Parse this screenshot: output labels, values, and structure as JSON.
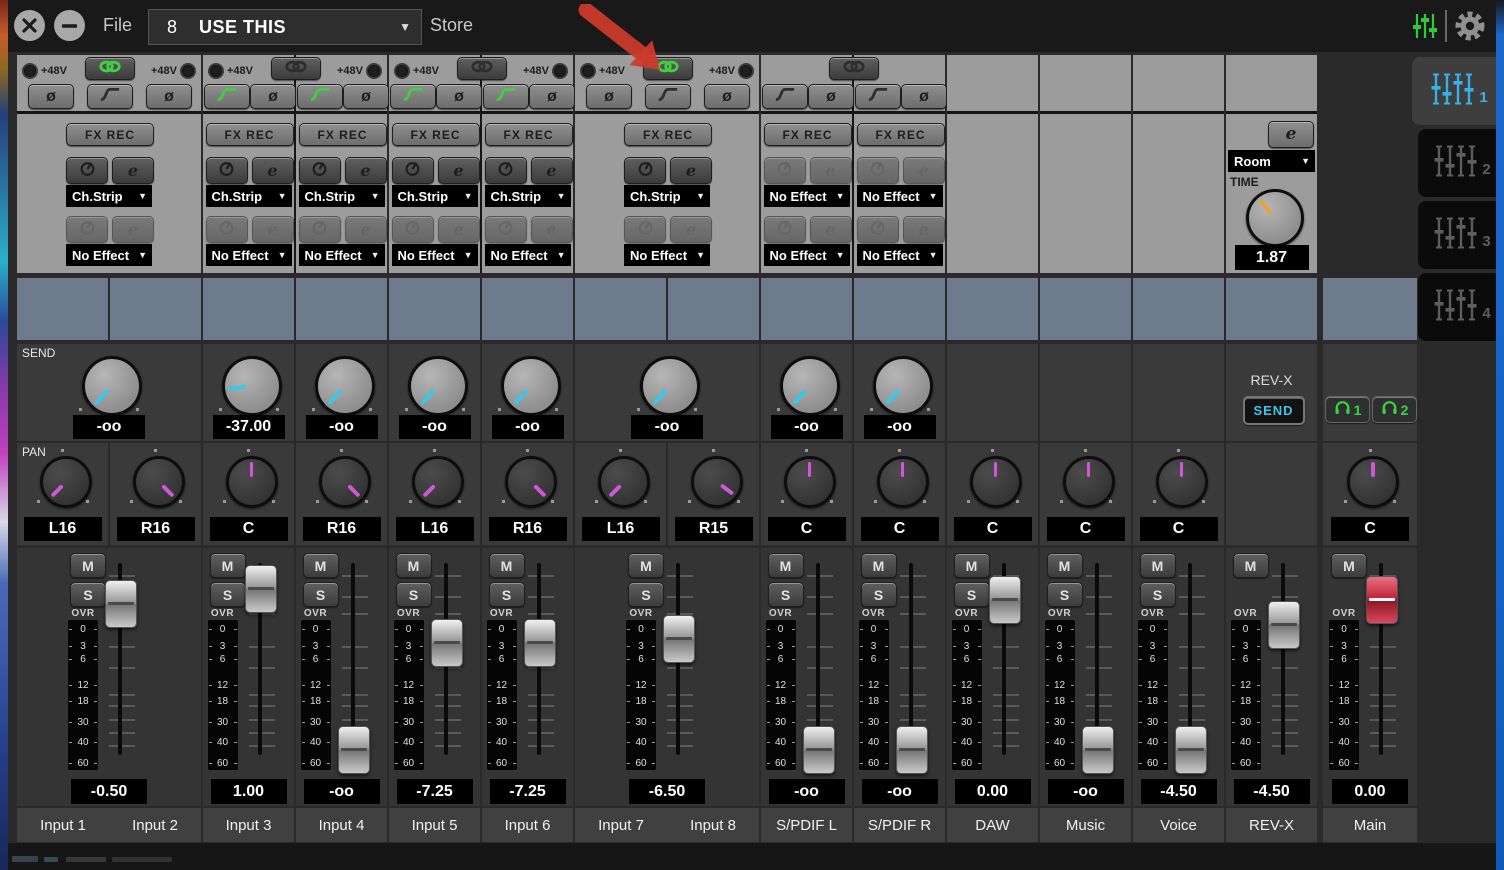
{
  "titlebar": {
    "file_label": "File",
    "preset_number": "8",
    "preset_name": "USE THIS",
    "store_label": "Store"
  },
  "labels": {
    "send_section": "SEND",
    "pan_section": "PAN",
    "ovr": "OVR",
    "phantom": "+48V",
    "fx_rec": "FX REC",
    "mute": "M",
    "solo": "S"
  },
  "meter_ticks": [
    "0",
    "3",
    "6",
    "12",
    "18",
    "30",
    "40",
    "60"
  ],
  "revx_editor": {
    "type_value": "Room",
    "time_label": "TIME",
    "time_value": "1.87"
  },
  "revx_send": {
    "title": "REV-X",
    "send_button": "SEND"
  },
  "phones": [
    {
      "label": "1"
    },
    {
      "label": "2"
    }
  ],
  "scene_tabs": [
    {
      "label": "1",
      "active": true
    },
    {
      "label": "2",
      "active": false
    },
    {
      "label": "3",
      "active": false
    },
    {
      "label": "4",
      "active": false
    }
  ],
  "strips": [
    {
      "id": "input-1-2",
      "type": "pair",
      "linked": true,
      "phantom": true,
      "names": [
        "Input 1",
        "Input 2"
      ],
      "fx": {
        "slot1": "Ch.Strip",
        "slot2": "No Effect",
        "active": true
      },
      "send": {
        "value": "-oo",
        "angle": -137
      },
      "pans": [
        {
          "value": "L16",
          "angle": -135
        },
        {
          "value": "R16",
          "angle": 135
        }
      ],
      "fader": {
        "value": "-0.50",
        "pos": 0.21
      }
    },
    {
      "id": "input-3-4",
      "type": "pair",
      "linked": false,
      "phantom": true,
      "names": [
        "Input 3",
        "Input 4"
      ],
      "channels": [
        {
          "hpf": true,
          "fx": {
            "slot1": "Ch.Strip",
            "slot2": "No Effect",
            "active": true
          },
          "send": {
            "value": "-37.00",
            "angle": -97
          },
          "pan": {
            "value": "C",
            "angle": 0
          },
          "fader": {
            "value": "1.00",
            "pos": 0.13
          }
        },
        {
          "hpf": true,
          "fx": {
            "slot1": "Ch.Strip",
            "slot2": "No Effect",
            "active": true
          },
          "send": {
            "value": "-oo",
            "angle": -137
          },
          "pan": {
            "value": "R16",
            "angle": 135
          },
          "fader": {
            "value": "-oo",
            "pos": 0.97
          }
        }
      ]
    },
    {
      "id": "input-5-6",
      "type": "pair",
      "linked": false,
      "phantom": true,
      "names": [
        "Input 5",
        "Input 6"
      ],
      "channels": [
        {
          "hpf": true,
          "fx": {
            "slot1": "Ch.Strip",
            "slot2": "No Effect",
            "active": true
          },
          "send": {
            "value": "-oo",
            "angle": -137
          },
          "pan": {
            "value": "L16",
            "angle": -135
          },
          "fader": {
            "value": "-7.25",
            "pos": 0.41
          }
        },
        {
          "hpf": true,
          "fx": {
            "slot1": "Ch.Strip",
            "slot2": "No Effect",
            "active": true
          },
          "send": {
            "value": "-oo",
            "angle": -137
          },
          "pan": {
            "value": "R16",
            "angle": 135
          },
          "fader": {
            "value": "-7.25",
            "pos": 0.41
          }
        }
      ]
    },
    {
      "id": "input-7-8",
      "type": "pair",
      "linked": true,
      "phantom": true,
      "names": [
        "Input 7",
        "Input 8"
      ],
      "fx": {
        "slot1": "Ch.Strip",
        "slot2": "No Effect",
        "active": true
      },
      "send": {
        "value": "-oo",
        "angle": -137
      },
      "pans": [
        {
          "value": "L16",
          "angle": -135
        },
        {
          "value": "R15",
          "angle": 127
        }
      ],
      "fader": {
        "value": "-6.50",
        "pos": 0.39
      }
    },
    {
      "id": "spdif",
      "type": "pair",
      "linked": false,
      "phantom": false,
      "names": [
        "S/PDIF L",
        "S/PDIF R"
      ],
      "channels": [
        {
          "hpf": false,
          "fx": {
            "slot1": "No Effect",
            "slot2": "No Effect",
            "active": false
          },
          "send": {
            "value": "-oo",
            "angle": -137
          },
          "pan": {
            "value": "C",
            "angle": 0
          },
          "fader": {
            "value": "-oo",
            "pos": 0.97
          }
        },
        {
          "hpf": false,
          "fx": {
            "slot1": "No Effect",
            "slot2": "No Effect",
            "active": false
          },
          "send": {
            "value": "-oo",
            "angle": -137
          },
          "pan": {
            "value": "C",
            "angle": 0
          },
          "fader": {
            "value": "-oo",
            "pos": 0.97
          }
        }
      ]
    },
    {
      "id": "daw",
      "type": "single",
      "name": "DAW",
      "pan": {
        "value": "C",
        "angle": 0
      },
      "fader": {
        "value": "0.00",
        "pos": 0.19
      }
    },
    {
      "id": "music",
      "type": "single",
      "name": "Music",
      "pan": {
        "value": "C",
        "angle": 0
      },
      "fader": {
        "value": "-oo",
        "pos": 0.97
      }
    },
    {
      "id": "voice",
      "type": "single",
      "name": "Voice",
      "pan": {
        "value": "C",
        "angle": 0
      },
      "fader": {
        "value": "-4.50",
        "pos": 0.97
      }
    },
    {
      "id": "revx",
      "type": "revx",
      "name": "REV-X",
      "fader": {
        "value": "-4.50",
        "pos": 0.32
      }
    },
    {
      "id": "main",
      "type": "main",
      "name": "Main",
      "pan": {
        "value": "C",
        "angle": 0
      },
      "fader": {
        "value": "0.00",
        "pos": 0.19
      }
    }
  ],
  "strip_fader_values": [
    "-0.50",
    "1.00",
    "-oo",
    "-7.25",
    "-7.25",
    "-6.50",
    "-oo",
    "-oo",
    "0.00",
    "-oo",
    "-oo",
    "-4.50",
    "0.00"
  ],
  "colors": {
    "accent_green": "#3fd13f",
    "accent_cyan": "#38c8ea",
    "pan_indicator": "#d058d8",
    "time_indicator": "#e8a23a",
    "main_fader_red": "#c8374a",
    "scene_active": "#38b0e8",
    "meter_bridge": "#6d7b8c",
    "inactive_icon": "#2e2e2e"
  }
}
